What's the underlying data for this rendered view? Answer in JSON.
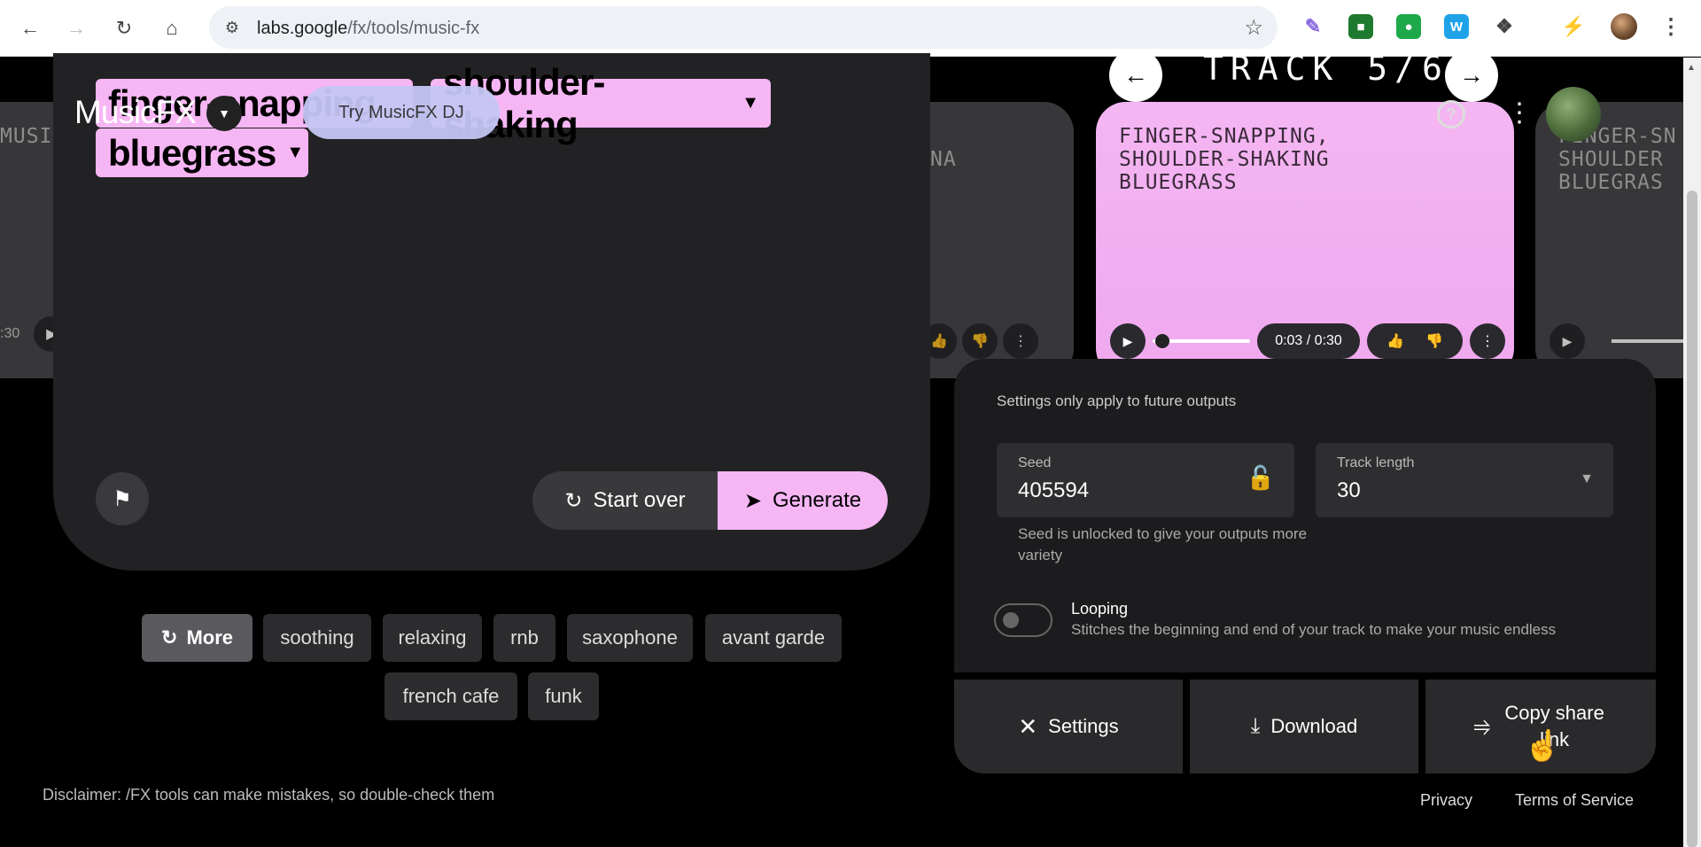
{
  "browser": {
    "url_host": "labs.google",
    "url_path": "/fx/tools/music-fx",
    "icons": {
      "back": "arrow-left-icon",
      "forward": "arrow-right-icon",
      "reload": "reload-icon",
      "home": "home-icon",
      "site": "tune-icon",
      "star": "star-icon",
      "extensions": "puzzle-icon",
      "profile": "avatar-icon",
      "menu": "kebab-icon"
    }
  },
  "app": {
    "name": "MusicFX",
    "dj_button": "Try MusicFX DJ",
    "prompt_chips": [
      "finger-snapping",
      "shoulder-shaking",
      "bluegrass"
    ],
    "start_over": "Start over",
    "generate": "Generate",
    "accent": "#f6b6f4"
  },
  "track_header": {
    "label": "TRACK 5/6"
  },
  "tracks": {
    "left_partial_title": "MUSI",
    "left_partial_time": ":30",
    "middle_partial_title": "NA",
    "active_title": "FINGER-SNAPPING, SHOULDER-SHAKING BLUEGRASS",
    "active_time": "0:03 / 0:30",
    "active_progress": 0.1,
    "right_partial_title": "FINGER-SN SHOULDER BLUEGRAS"
  },
  "suggestions": {
    "more": "More",
    "items": [
      "soothing",
      "relaxing",
      "rnb",
      "saxophone",
      "avant garde",
      "french cafe",
      "funk"
    ]
  },
  "settings": {
    "note": "Settings only apply to future outputs",
    "seed_label": "Seed",
    "seed_value": "405594",
    "seed_help": "Seed is unlocked to give your outputs more variety",
    "track_length_label": "Track length",
    "track_length_value": "30",
    "looping_title": "Looping",
    "looping_desc": "Stitches the beginning and end of your track to make your music endless",
    "looping_on": false
  },
  "actions": {
    "settings": "Settings",
    "download": "Download",
    "copy_share": "Copy share link"
  },
  "footer": {
    "disclaimer": "Disclaimer: /FX tools can make mistakes, so double-check them",
    "privacy": "Privacy",
    "terms": "Terms of Service"
  }
}
